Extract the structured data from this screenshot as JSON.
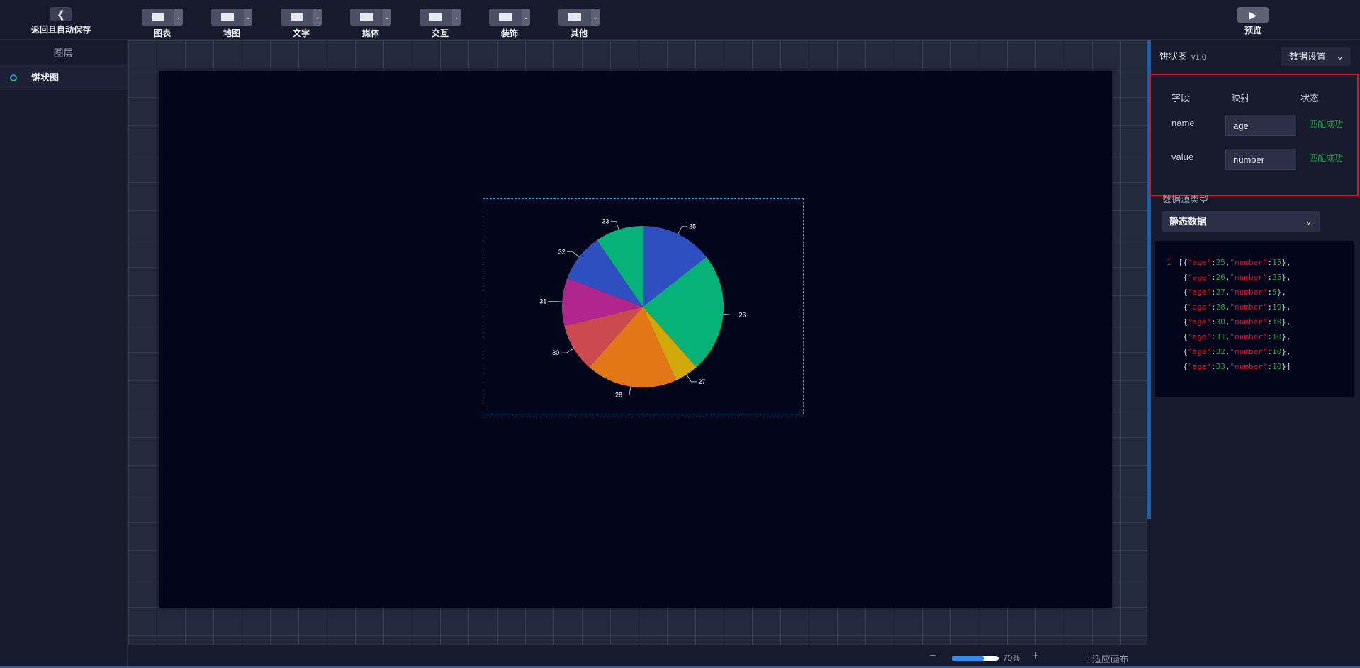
{
  "topbar": {
    "back_label": "返回且自动保存",
    "back_icon": "chevron-left-icon",
    "tools": [
      {
        "label": "图表",
        "icon": "chart-icon"
      },
      {
        "label": "地图",
        "icon": "map-icon"
      },
      {
        "label": "文字",
        "icon": "text-icon"
      },
      {
        "label": "媒体",
        "icon": "media-icon"
      },
      {
        "label": "交互",
        "icon": "interaction-icon"
      },
      {
        "label": "装饰",
        "icon": "decoration-icon"
      },
      {
        "label": "其他",
        "icon": "other-icon"
      }
    ],
    "preview_label": "预览",
    "preview_icon": "play-icon"
  },
  "layers": {
    "title": "图层",
    "items": [
      {
        "label": "饼状图"
      }
    ]
  },
  "bottombar": {
    "zoom_percent": "70%",
    "zoom_value": 0.7,
    "fit_label": "适应画布"
  },
  "right_panel": {
    "title": "饼状图",
    "version": "v1.0",
    "settings_button": "数据设置",
    "mapping": {
      "headers": {
        "field": "字段",
        "mapping": "映射",
        "status": "状态"
      },
      "rows": [
        {
          "field": "name",
          "value": "age",
          "status": "匹配成功"
        },
        {
          "field": "value",
          "value": "number",
          "status": "匹配成功"
        }
      ]
    },
    "datasource_label": "数据源类型",
    "datasource_value": "静态数据",
    "code_line_number": "1",
    "code_data": [
      {
        "age": 25,
        "number": 15
      },
      {
        "age": 26,
        "number": 25
      },
      {
        "age": 27,
        "number": 5
      },
      {
        "age": 28,
        "number": 19
      },
      {
        "age": 30,
        "number": 10
      },
      {
        "age": 31,
        "number": 10
      },
      {
        "age": 32,
        "number": 10
      },
      {
        "age": 33,
        "number": 10
      }
    ]
  },
  "colors": {
    "accent": "#1f5fa8",
    "success": "#22a043",
    "highlight_border": "#e0131f",
    "selection_border": "#2aa6c8"
  },
  "chart_data": {
    "type": "pie",
    "categories": [
      "25",
      "26",
      "27",
      "28",
      "30",
      "31",
      "32",
      "33"
    ],
    "values": [
      15,
      25,
      5,
      19,
      10,
      10,
      10,
      10
    ],
    "colors": [
      "#2e4fbf",
      "#06b277",
      "#d1a80a",
      "#e37718",
      "#cc4a4e",
      "#b1258f",
      "#2e4fbf",
      "#06b277"
    ],
    "title": "",
    "legend": "none"
  }
}
